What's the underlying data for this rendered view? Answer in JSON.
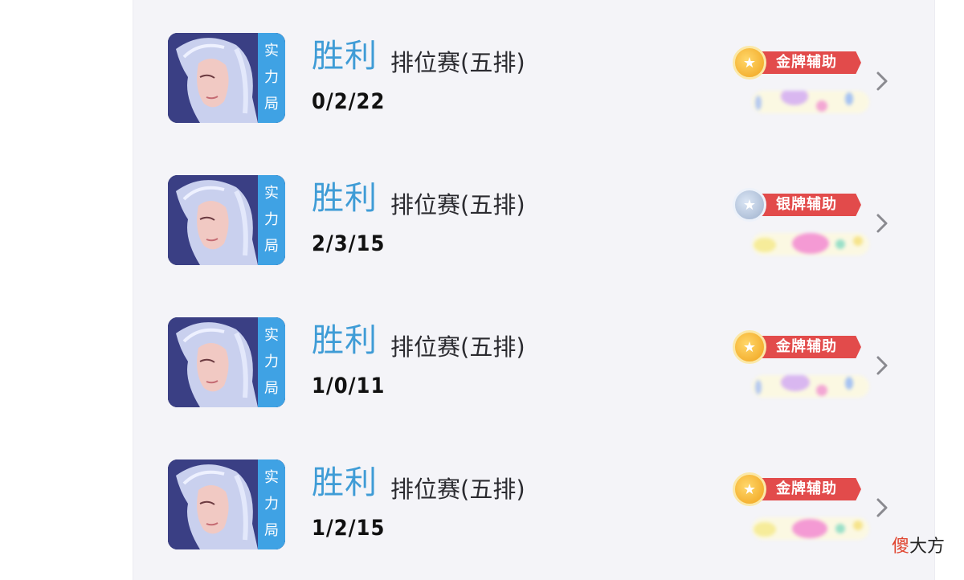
{
  "matches": [
    {
      "avatar_tag": [
        "实",
        "力",
        "局"
      ],
      "result": "胜利",
      "mode": "排位赛(五排)",
      "kda": "0/2/22",
      "badge": "金牌辅助",
      "badge_tier": "gold"
    },
    {
      "avatar_tag": [
        "实",
        "力",
        "局"
      ],
      "result": "胜利",
      "mode": "排位赛(五排)",
      "kda": "2/3/15",
      "badge": "银牌辅助",
      "badge_tier": "silver"
    },
    {
      "avatar_tag": [
        "实",
        "力",
        "局"
      ],
      "result": "胜利",
      "mode": "排位赛(五排)",
      "kda": "1/0/11",
      "badge": "金牌辅助",
      "badge_tier": "gold"
    },
    {
      "avatar_tag": [
        "实",
        "力",
        "局"
      ],
      "result": "胜利",
      "mode": "排位赛(五排)",
      "kda": "1/2/15",
      "badge": "金牌辅助",
      "badge_tier": "gold"
    }
  ],
  "watermark": {
    "first_char": "傻",
    "rest": "大方"
  },
  "icons": {
    "chevron": "chevron-right-icon",
    "medal": "star-medal-icon"
  },
  "colors": {
    "result_blue": "#3f9cd6",
    "tag_blue": "#3fa2e4",
    "ribbon_red": "#e24b4b"
  }
}
